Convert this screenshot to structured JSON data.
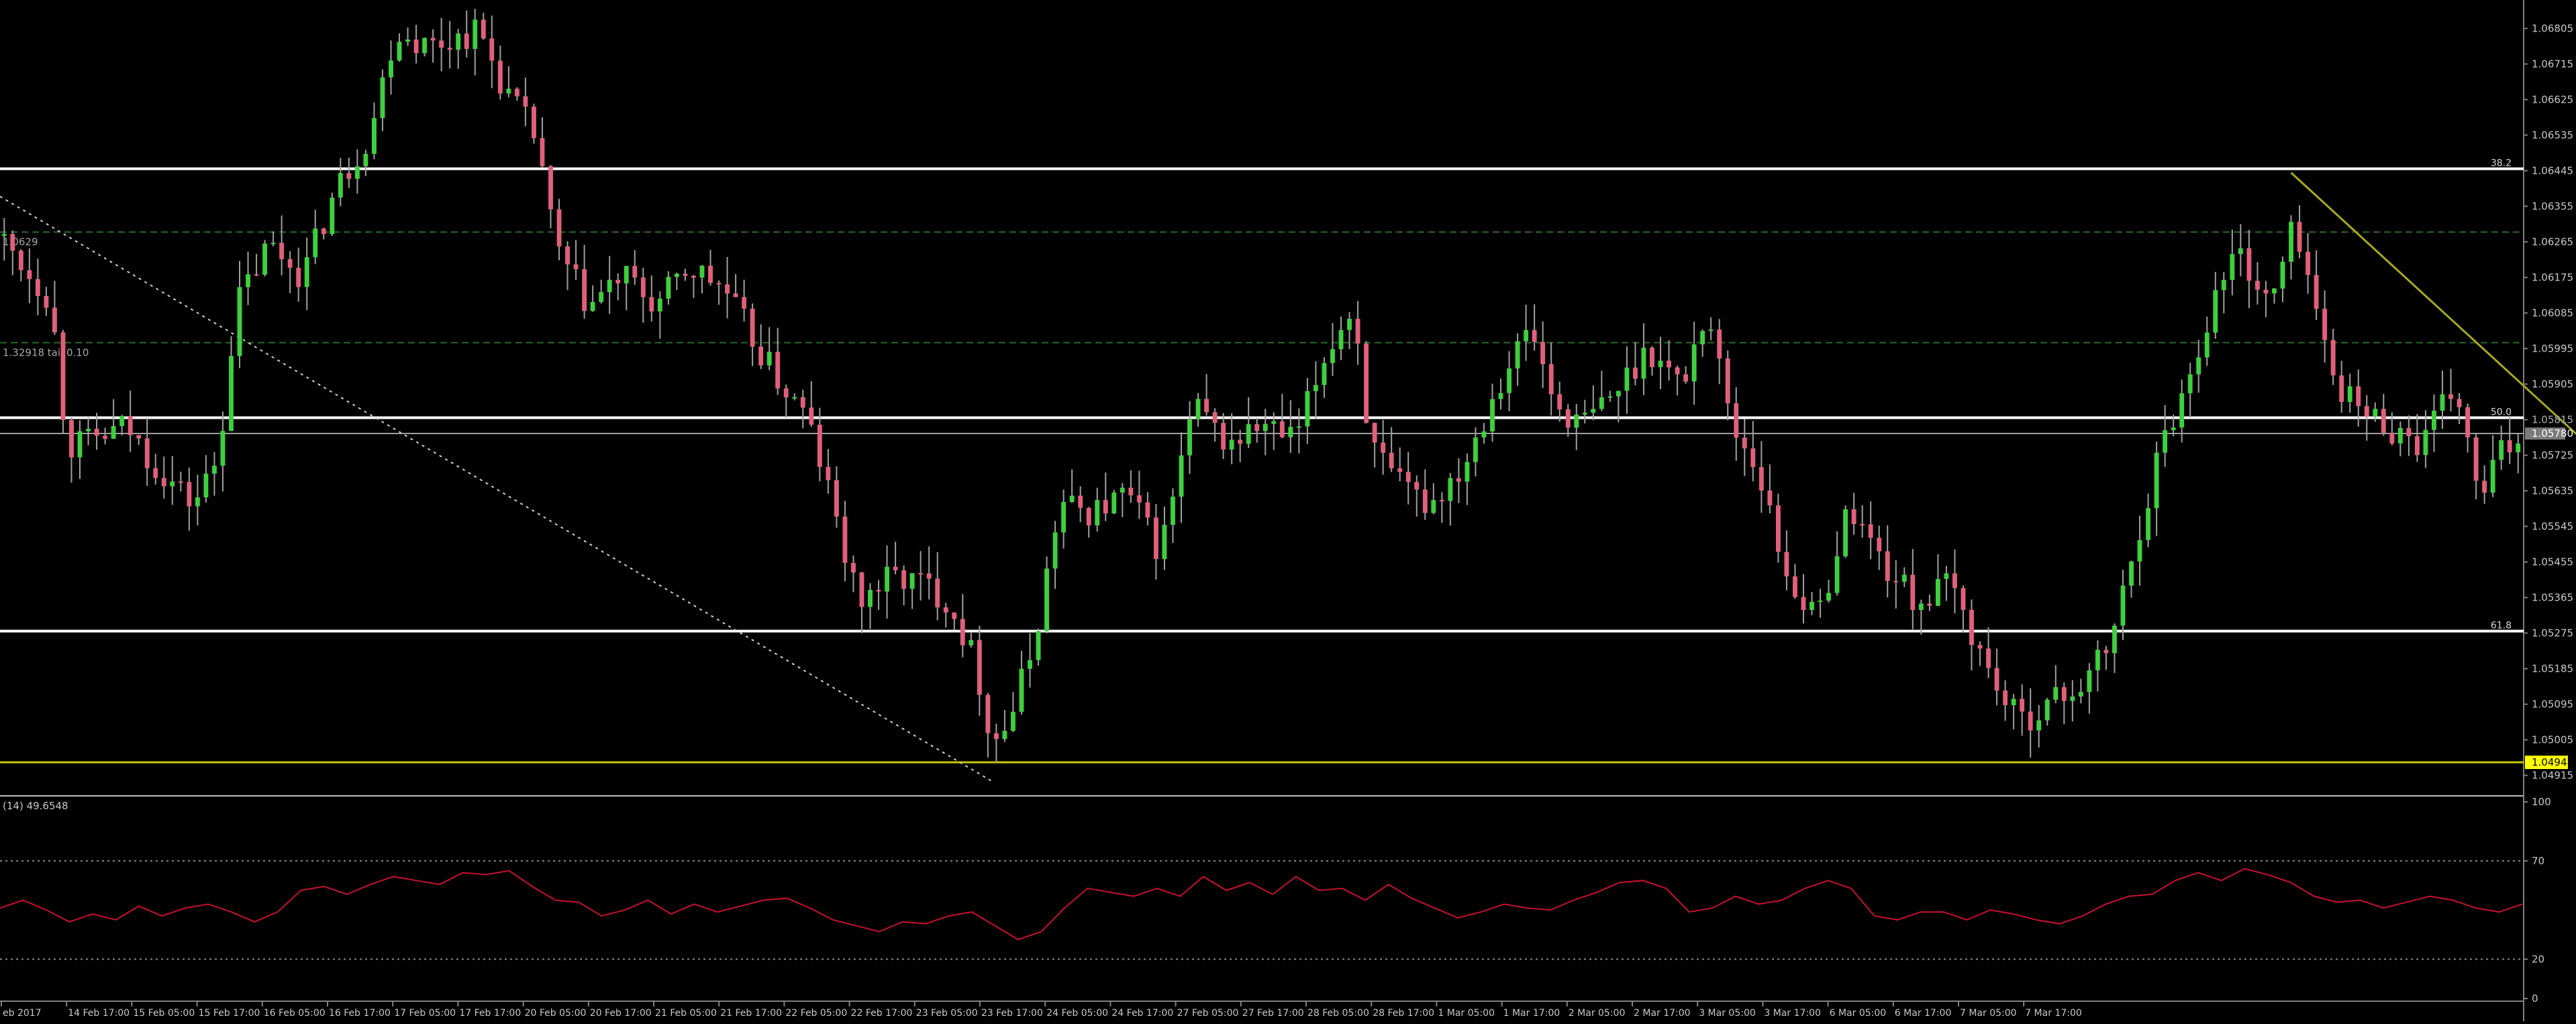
{
  "chart_data": [
    {
      "type": "candlestick",
      "panel": "main",
      "y_ticks": [
        "1.06805",
        "1.06715",
        "1.06625",
        "1.06535",
        "1.06445",
        "1.06355",
        "1.06265",
        "1.06175",
        "1.06085",
        "1.05995",
        "1.05905",
        "1.05815",
        "1.05725",
        "1.05635",
        "1.05545",
        "1.05455",
        "1.05365",
        "1.05275",
        "1.05185",
        "1.05095",
        "1.05005",
        "1.04915"
      ],
      "ylim": [
        1.0487,
        1.0686
      ],
      "bid_label": "1.04948",
      "bid_value": 1.04948,
      "current_price_label": "1.05780",
      "current_price_value": 1.0578,
      "upper_price_label": "1.05815",
      "fib_levels": [
        {
          "label": "38.2",
          "value": 1.0645
        },
        {
          "label": "50.0",
          "value": 1.0582
        },
        {
          "label": "61.8",
          "value": 1.0528
        }
      ],
      "dashed_levels": [
        {
          "label": "1.0629",
          "value": 1.0629
        },
        {
          "label": "1.32918 tail 0.10",
          "value": 1.0601
        }
      ],
      "trendlines": [
        {
          "name": "dotted-trendline",
          "from": [
            0,
            1.0638
          ],
          "to": [
            1180,
            1.049
          ]
        },
        {
          "name": "yellow-trendline",
          "from": [
            2725,
            1.0644
          ],
          "to": [
            3515,
            1.049
          ]
        }
      ],
      "price_path": [
        [
          0,
          1.0628
        ],
        [
          60,
          1.0612
        ],
        [
          80,
          1.0575
        ],
        [
          110,
          1.0576
        ],
        [
          150,
          1.058
        ],
        [
          180,
          1.0571
        ],
        [
          230,
          1.056
        ],
        [
          260,
          1.0572
        ],
        [
          280,
          1.061
        ],
        [
          320,
          1.0626
        ],
        [
          360,
          1.0618
        ],
        [
          400,
          1.064
        ],
        [
          440,
          1.0654
        ],
        [
          470,
          1.068
        ],
        [
          510,
          1.0676
        ],
        [
          570,
          1.068
        ],
        [
          600,
          1.0665
        ],
        [
          640,
          1.0652
        ],
        [
          660,
          1.0625
        ],
        [
          700,
          1.061
        ],
        [
          740,
          1.0618
        ],
        [
          780,
          1.061
        ],
        [
          820,
          1.062
        ],
        [
          860,
          1.0615
        ],
        [
          900,
          1.06
        ],
        [
          930,
          1.059
        ],
        [
          960,
          1.0582
        ],
        [
          990,
          1.056
        ],
        [
          1020,
          1.0535
        ],
        [
          1060,
          1.0542
        ],
        [
          1100,
          1.054
        ],
        [
          1130,
          1.0535
        ],
        [
          1160,
          1.052
        ],
        [
          1180,
          1.05
        ],
        [
          1200,
          1.0505
        ],
        [
          1230,
          1.0525
        ],
        [
          1260,
          1.056
        ],
        [
          1300,
          1.0558
        ],
        [
          1340,
          1.0563
        ],
        [
          1380,
          1.0548
        ],
        [
          1420,
          1.0585
        ],
        [
          1460,
          1.0575
        ],
        [
          1500,
          1.058
        ],
        [
          1540,
          1.0576
        ],
        [
          1580,
          1.06
        ],
        [
          1610,
          1.061
        ],
        [
          1630,
          1.0575
        ],
        [
          1660,
          1.0565
        ],
        [
          1700,
          1.056
        ],
        [
          1740,
          1.057
        ],
        [
          1780,
          1.059
        ],
        [
          1820,
          1.0605
        ],
        [
          1850,
          1.0585
        ],
        [
          1880,
          1.058
        ],
        [
          1920,
          1.0588
        ],
        [
          1960,
          1.06
        ],
        [
          2000,
          1.059
        ],
        [
          2030,
          1.061
        ],
        [
          2060,
          1.058
        ],
        [
          2090,
          1.057
        ],
        [
          2120,
          1.0545
        ],
        [
          2160,
          1.053
        ],
        [
          2200,
          1.056
        ],
        [
          2240,
          1.0545
        ],
        [
          2280,
          1.0535
        ],
        [
          2320,
          1.054
        ],
        [
          2360,
          1.052
        ],
        [
          2400,
          1.0505
        ],
        [
          2440,
          1.051
        ],
        [
          2480,
          1.0515
        ],
        [
          2510,
          1.0525
        ],
        [
          2540,
          1.055
        ],
        [
          2570,
          1.0575
        ],
        [
          2600,
          1.059
        ],
        [
          2630,
          1.061
        ],
        [
          2660,
          1.0625
        ],
        [
          2700,
          1.061
        ],
        [
          2730,
          1.0632
        ],
        [
          2770,
          1.0595
        ],
        [
          2800,
          1.0585
        ],
        [
          2840,
          1.058
        ],
        [
          2880,
          1.0575
        ],
        [
          2920,
          1.059
        ],
        [
          2950,
          1.056
        ],
        [
          2970,
          1.0572
        ],
        [
          3000,
          1.0578
        ]
      ],
      "candle_count": 300
    },
    {
      "type": "line",
      "panel": "indicator",
      "label": "(14) 49.6548",
      "y_ticks": [
        "100",
        "70",
        "20",
        "0"
      ],
      "ylim": [
        0,
        100
      ],
      "levels": [
        70,
        20
      ],
      "line_color": "#c8102e",
      "x_range": [
        0,
        3000
      ],
      "values": [
        46,
        50,
        45,
        39,
        43,
        40,
        47,
        42,
        46,
        48,
        44,
        39,
        44,
        55,
        57,
        53,
        58,
        62,
        60,
        58,
        64,
        63,
        65,
        57,
        50,
        49,
        42,
        45,
        50,
        43,
        48,
        44,
        47,
        50,
        51,
        46,
        40,
        37,
        34,
        39,
        38,
        42,
        44,
        37,
        30,
        34,
        46,
        56,
        54,
        52,
        56,
        52,
        62,
        55,
        59,
        53,
        62,
        55,
        56,
        50,
        58,
        51,
        46,
        41,
        44,
        48,
        46,
        45,
        50,
        54,
        59,
        60,
        56,
        44,
        46,
        52,
        48,
        50,
        56,
        60,
        56,
        42,
        40,
        44,
        44,
        40,
        45,
        43,
        40,
        38,
        42,
        48,
        52,
        53,
        60,
        64,
        60,
        66,
        63,
        59,
        52,
        49,
        50,
        46,
        49,
        52,
        50,
        46,
        44,
        48
      ]
    }
  ],
  "x_axis": {
    "tick_labels": [
      "eb 2017",
      "14 Feb 17:00",
      "15 Feb 05:00",
      "15 Feb 17:00",
      "16 Feb 05:00",
      "16 Feb 17:00",
      "17 Feb 05:00",
      "17 Feb 17:00",
      "20 Feb 05:00",
      "20 Feb 17:00",
      "21 Feb 05:00",
      "21 Feb 17:00",
      "22 Feb 05:00",
      "22 Feb 17:00",
      "23 Feb 05:00",
      "23 Feb 17:00",
      "24 Feb 05:00",
      "24 Feb 17:00",
      "27 Feb 05:00",
      "27 Feb 17:00",
      "28 Feb 05:00",
      "28 Feb 17:00",
      "1 Mar 05:00",
      "1 Mar 17:00",
      "2 Mar 05:00",
      "2 Mar 17:00",
      "3 Mar 05:00",
      "3 Mar 17:00",
      "6 Mar 05:00",
      "6 Mar 17:00",
      "7 Mar 05:00",
      "7 Mar 17:00"
    ]
  },
  "colors": {
    "background": "#000000",
    "bull_candle": "#3ecf3e",
    "bear_candle": "#e0607a",
    "wick": "#a0a0a0",
    "fib_line": "#ffffff",
    "bid_line": "#c8c800",
    "bid_label_bg": "#ffff00",
    "trendline_yellow": "#a8a820",
    "dashed_level": "#2a6a2a",
    "axis_text": "#c8c8c8",
    "rsi_line": "#c8102e"
  }
}
